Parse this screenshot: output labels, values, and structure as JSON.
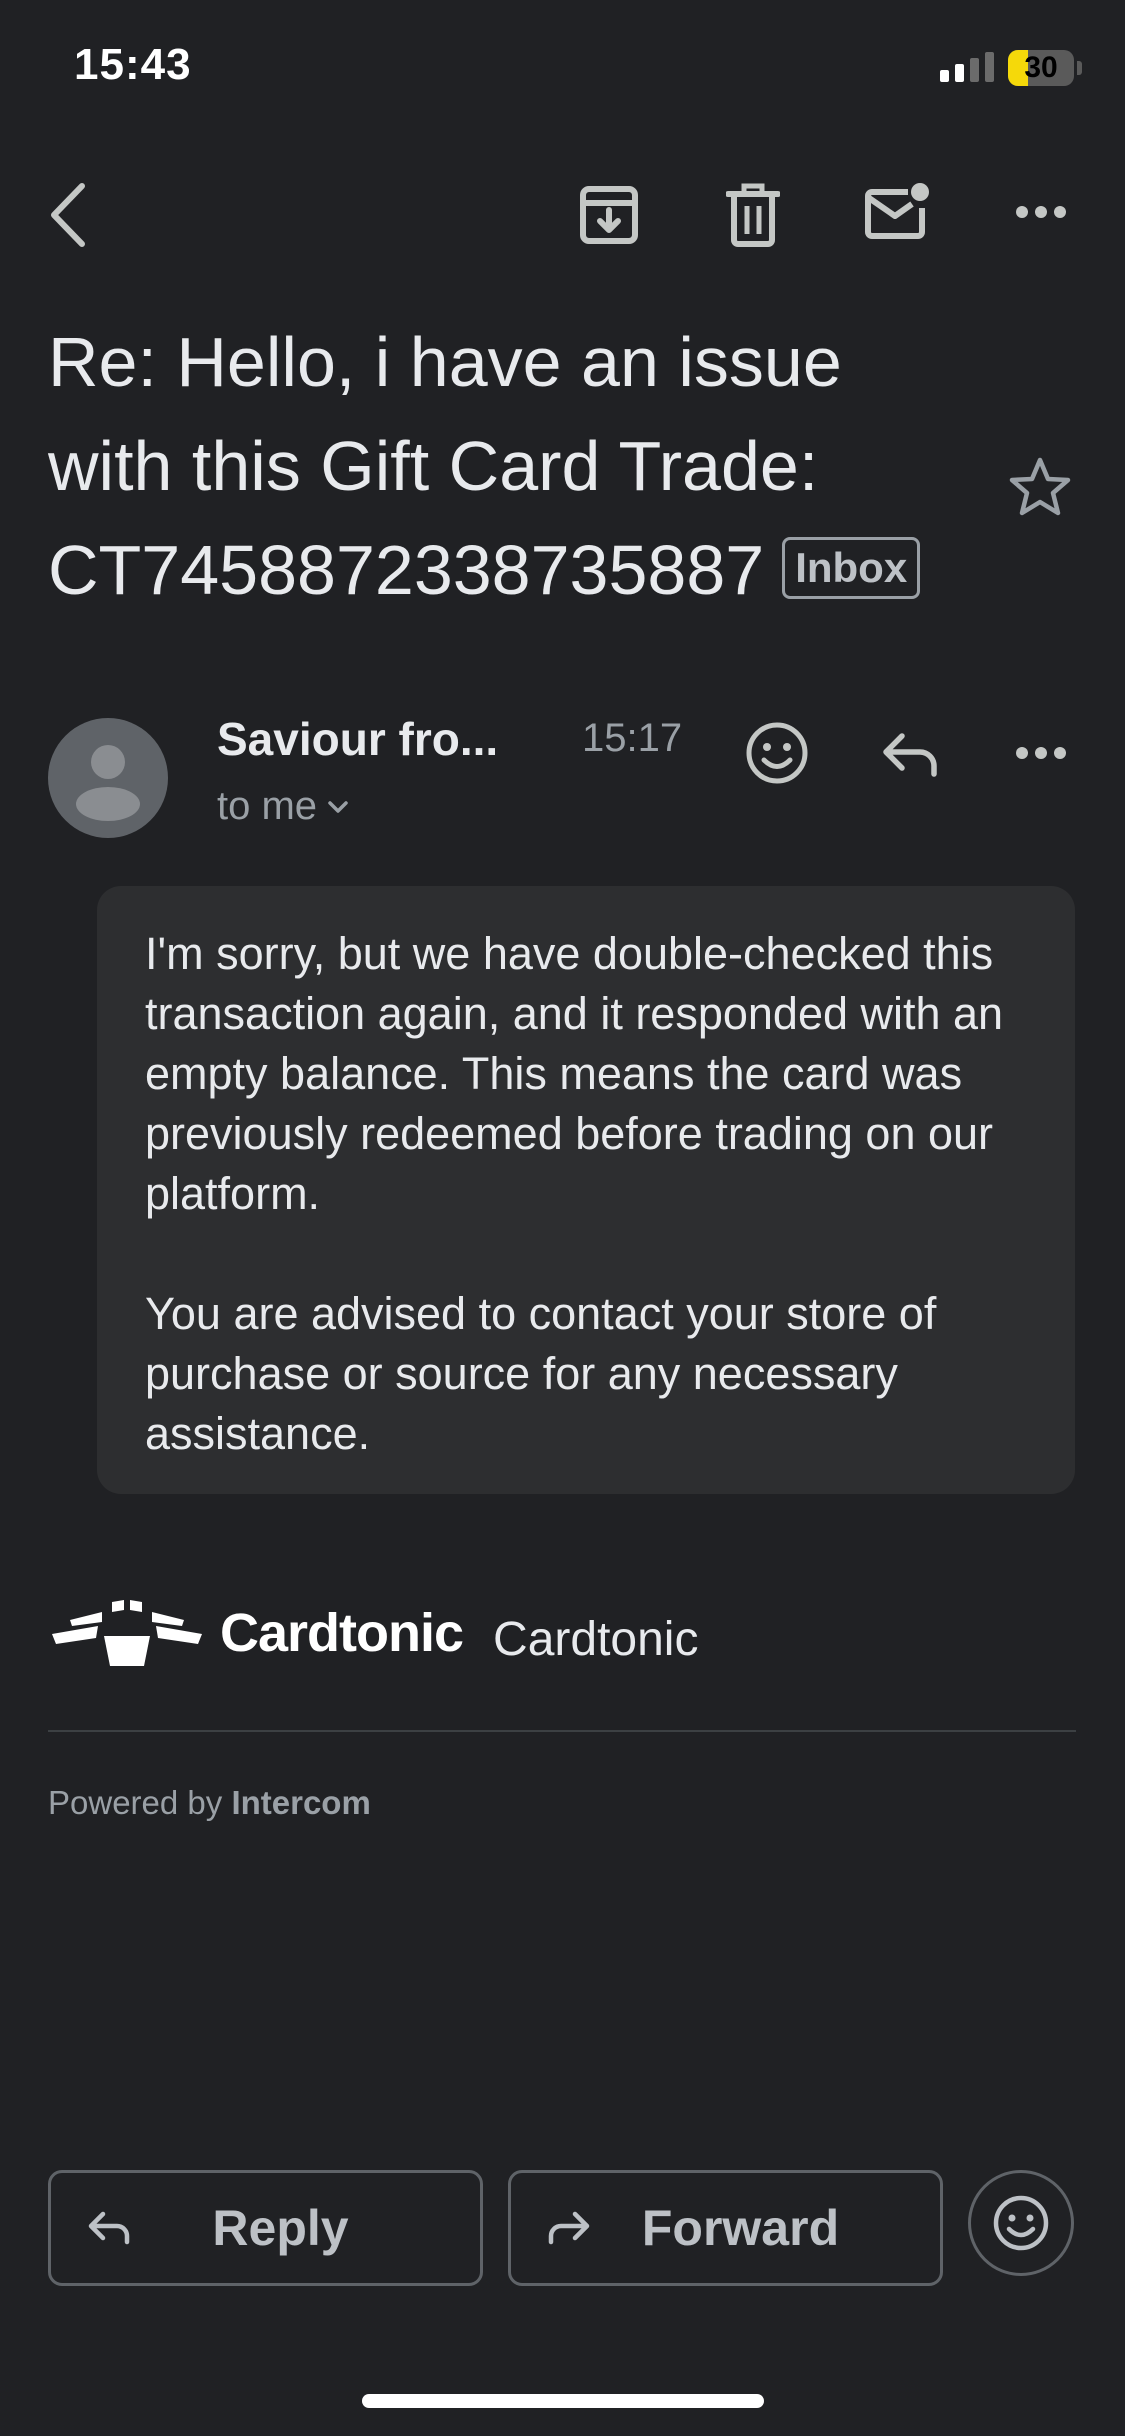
{
  "status_bar": {
    "time": "15:43",
    "battery_percent": "30",
    "battery_level": 0.3,
    "signal_bars_active": 2,
    "signal_bars_total": 4,
    "battery_color": "#f5d90a"
  },
  "toolbar": {
    "icons": [
      "back-arrow-icon",
      "archive-icon",
      "trash-icon",
      "mark-unread-icon",
      "more-icon"
    ]
  },
  "email": {
    "subject": "Re: Hello, i have an issue with this Gift Card Trade: CT7458872338735887",
    "label_chip": "Inbox",
    "starred": false,
    "sender_name": "Saviour fro...",
    "time": "15:17",
    "recipient": "to me",
    "body_paragraphs": [
      "I'm sorry, but we have double-checked this transaction again, and it responded with an empty balance. This means the card was previously redeemed before trading on our platform.",
      "You are advised to contact your store of purchase or source for any necessary assistance."
    ]
  },
  "signature": {
    "logo_text": "Cardtonic",
    "sender_signature": "Cardtonic",
    "powered_by_prefix": "Powered by",
    "powered_by_brand": "Intercom"
  },
  "actions": {
    "reply_label": "Reply",
    "forward_label": "Forward"
  },
  "colors": {
    "background": "#202124",
    "card": "#2d2e30",
    "text_primary": "#e8eaed",
    "text_secondary": "#9aa0a6"
  }
}
